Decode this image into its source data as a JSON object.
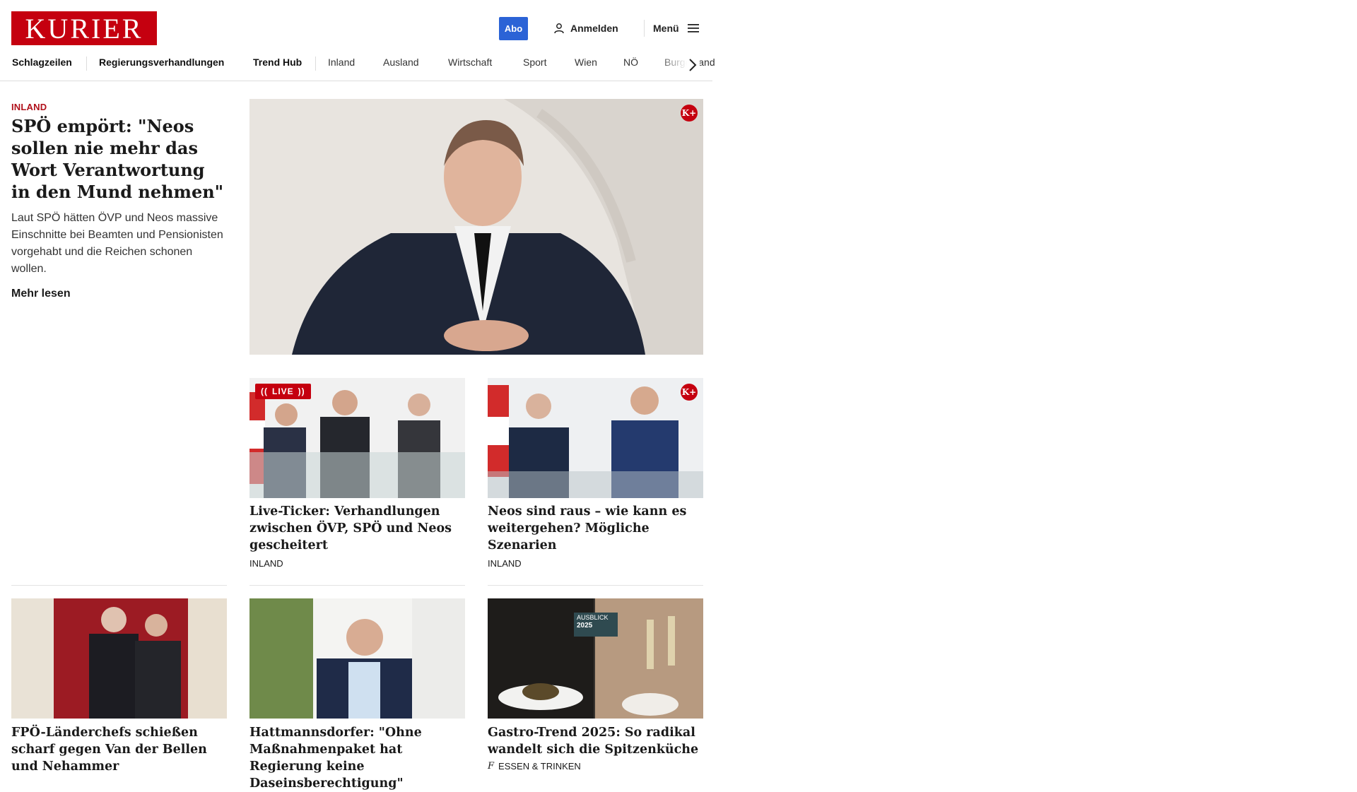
{
  "header": {
    "logo_text": "KURIER",
    "abo_label": "Abo",
    "login_label": "Anmelden",
    "menu_label": "Menü"
  },
  "nav": {
    "items": [
      "Schlagzeilen",
      "Regierungsverhandlungen",
      "Trend Hub",
      "Inland",
      "Ausland",
      "Wirtschaft",
      "Sport",
      "Wien",
      "NÖ",
      "Burgenland"
    ]
  },
  "lead": {
    "kicker": "INLAND",
    "title": "SPÖ empört: \"Neos sollen nie mehr das Wort Verantwortung in den Mund nehmen\"",
    "teaser": "Laut SPÖ hätten ÖVP und Neos massive Einschnitte bei Beamten und Pensionisten vorgehabt und die Reichen schonen wollen.",
    "more_label": "Mehr lesen",
    "plus_badge": "K+"
  },
  "cards": [
    {
      "title": "Live-Ticker: Verhandlungen zwischen ÖVP, SPÖ und Neos gescheitert",
      "kicker": "INLAND",
      "badge": "LIVE"
    },
    {
      "title": "Neos sind raus – wie kann es weitergehen? Mögliche Szenarien",
      "kicker": "INLAND",
      "badge": "K+"
    },
    {
      "title": "FPÖ-Länderchefs schießen scharf gegen Van der Bellen und Nehammer",
      "kicker": ""
    },
    {
      "title": "Hattmannsdorfer: \"Ohne Maßnahmenpaket hat Regierung keine Daseinsberechtigung\"",
      "kicker": ""
    },
    {
      "title": "Gastro-Trend 2025: So radikal wandelt sich die Spitzenküche",
      "kicker": "ESSEN & TRINKEN",
      "image_label_1": "AUSBLICK",
      "image_label_2": "2025"
    }
  ],
  "colors": {
    "brand": "#c5000f",
    "abo": "#2b63d6",
    "kicker": "#b0101a"
  }
}
